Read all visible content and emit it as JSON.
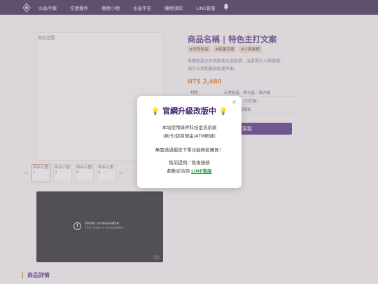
{
  "nav": {
    "items": [
      "水晶手鍊",
      "空間擺件",
      "療癒小物",
      "水晶宇宙",
      "購物須知",
      "LINE客服"
    ]
  },
  "product": {
    "image_alt": "商品主圖",
    "title": "商品名稱 | 特色主打文案",
    "tags": [
      "#天然粉晶",
      "#能量手鍊",
      "#人氣推薦"
    ],
    "description": [
      "柔嫩粉晶主石搭配紫水晶點綴，溫柔提升人際緣場，",
      "適合日常配戴與能量平衡。"
    ],
    "price": "NT$ 2,480",
    "specs": [
      {
        "key": "材質",
        "value": "天然粉晶・紫水晶・彈力繩"
      },
      {
        "key": "",
        "value": "約 16 cm（可訂製）"
      },
      {
        "key": "",
        "value": "水晶卡・收藏袋"
      }
    ],
    "order_label": "訂購／客製",
    "thumbnails": [
      "商品小圖1",
      "商品小圖2",
      "商品小圖3",
      "商品小圖4"
    ],
    "thumb_prev": "<",
    "thumb_next": ">"
  },
  "video": {
    "title": "Video unavailable",
    "subtitle": "This video is unavailable"
  },
  "section": {
    "details_title": "商品詳情"
  },
  "modal": {
    "close": "×",
    "bulb": "💡",
    "title": "官網升級改版中",
    "line1": "本站使用綠界科技金流系統",
    "line2": "(刷卡/超商現金/ATM帳號)",
    "line3": "無需透過蝦皮下單也能輕鬆購買！",
    "line4": "售前提問／售後服務",
    "line5_prefix": "都歡迎洽詢",
    "line5_link": "LINE客服"
  },
  "colors": {
    "nav_bg": "#2b1a3d",
    "brand_purple": "#4b2d73",
    "price": "#e07a2a",
    "line_green": "#27a844"
  }
}
